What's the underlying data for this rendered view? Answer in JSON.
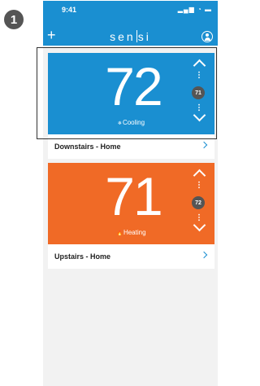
{
  "step_number": "1",
  "status_bar": {
    "time": "9:41",
    "icons": "▂▄▆ ◔ ▬"
  },
  "header": {
    "add_label": "+",
    "logo_left": "sen",
    "logo_right": "si"
  },
  "thermostats": [
    {
      "temperature": "72",
      "mode": "Cooling",
      "mode_icon": "❄",
      "setpoint": "71",
      "name": "Downstairs - Home",
      "color": "#1a8fd1",
      "selected": true
    },
    {
      "temperature": "71",
      "mode": "Heating",
      "mode_icon": "🔥",
      "setpoint": "72",
      "name": "Upstairs - Home",
      "color": "#f06a26",
      "selected": false
    }
  ],
  "colors": {
    "header": "#1a8fd1",
    "cooling": "#1a8fd1",
    "heating": "#f06a26",
    "badge": "#555555",
    "background": "#f2f2f2"
  }
}
